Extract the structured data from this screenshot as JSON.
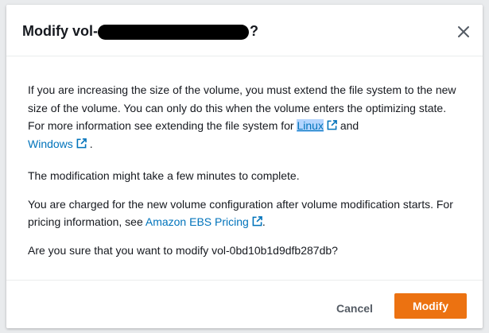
{
  "dialog": {
    "title_prefix": "Modify vol-",
    "title_suffix": "?",
    "body": {
      "p1_text": "If you are increasing the size of the volume, you must extend the file system to the new size of the volume. You can only do this when the volume enters the optimizing state. For more information see extending the file system for ",
      "p1_link_linux": "Linux",
      "p1_and": " and",
      "p1_link_windows": "Windows",
      "p1_end": ".",
      "p2_text": "The modification might take a few minutes to complete.",
      "p3_text": "You are charged for the new volume configuration after volume modification starts. For pricing information, see ",
      "p3_link": "Amazon EBS Pricing",
      "p3_end": ".",
      "p4_text": "Are you sure that you want to modify vol-0bd10b1d9dfb287db?"
    },
    "footer": {
      "cancel_label": "Cancel",
      "modify_label": "Modify"
    }
  },
  "colors": {
    "link": "#0073bb",
    "primary": "#ec7211",
    "text": "#16191f",
    "secondary_text": "#545b64"
  },
  "icons": {
    "close": "close-icon",
    "external_link": "external-link-icon"
  }
}
